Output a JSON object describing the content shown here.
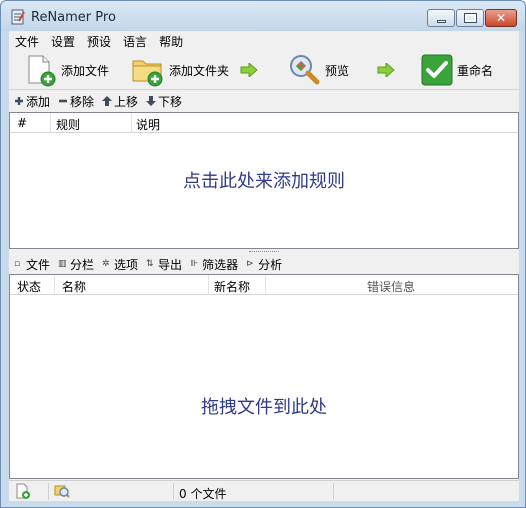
{
  "window": {
    "title": "ReNamer Pro"
  },
  "menu": [
    "文件",
    "设置",
    "预设",
    "语言",
    "帮助"
  ],
  "toolbar": {
    "add_files": "添加文件",
    "add_folders": "添加文件夹",
    "preview": "预览",
    "rename": "重命名"
  },
  "rules_toolbar": {
    "add": "添加",
    "remove": "移除",
    "move_up": "上移",
    "move_down": "下移"
  },
  "rules_table": {
    "columns": [
      "#",
      "规则",
      "说明"
    ],
    "empty_hint": "点击此处来添加规则"
  },
  "files_toolbar": {
    "files": "文件",
    "columns": "分栏",
    "options": "选项",
    "export": "导出",
    "filters": "筛选器",
    "analyze": "分析"
  },
  "files_table": {
    "columns": [
      "状态",
      "名称",
      "新名称",
      "错误信息"
    ],
    "empty_hint": "拖拽文件到此处"
  },
  "status": {
    "file_count": "0 个文件"
  },
  "colors": {
    "accent_green": "#3aa33a",
    "hint_text": "#2e3a8c",
    "close_red": "#c8482a"
  }
}
